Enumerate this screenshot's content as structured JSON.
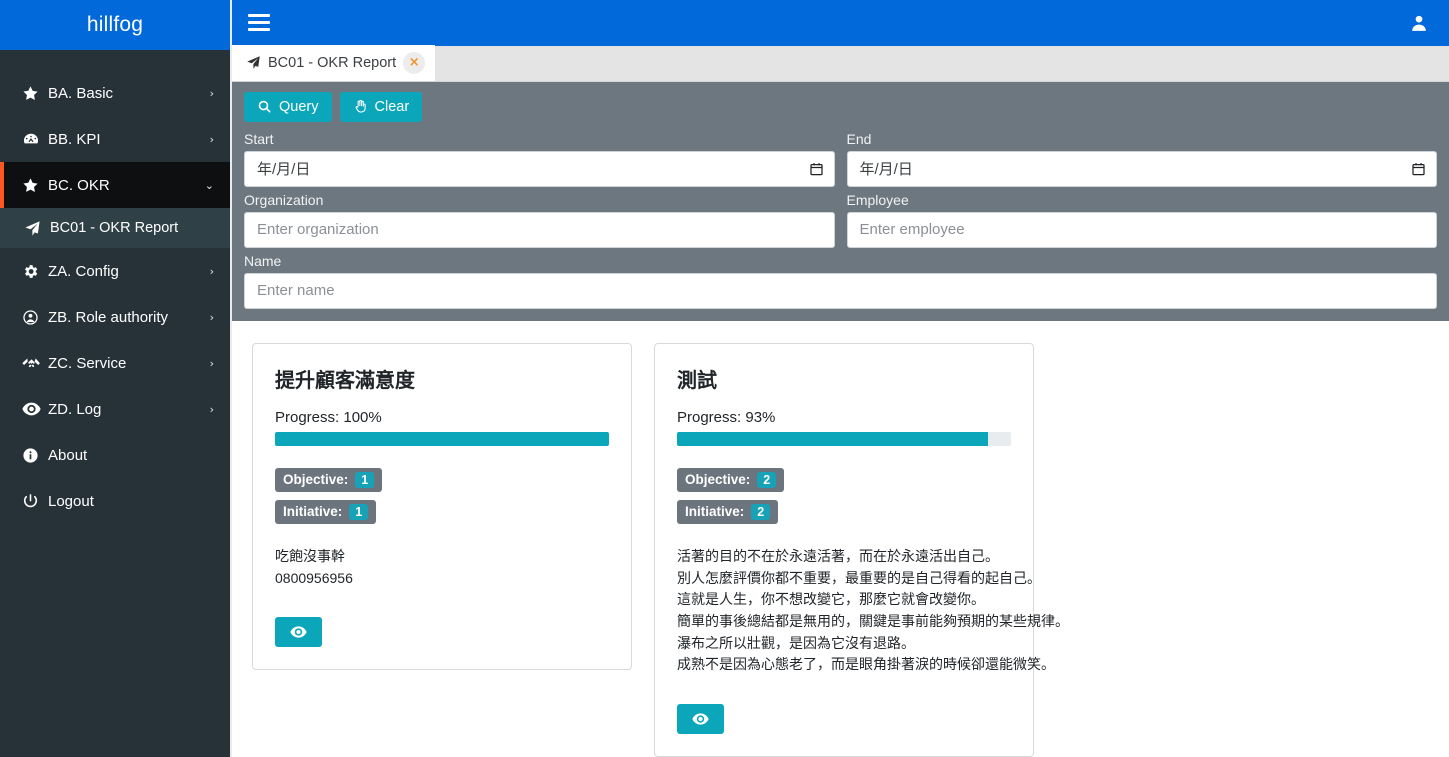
{
  "brand": {
    "name": "hillfog"
  },
  "sidebar": {
    "items": [
      {
        "label": "BA. Basic",
        "icon": "star-icon",
        "caret": "›",
        "state": "collapsed"
      },
      {
        "label": "BB. KPI",
        "icon": "dashboard-icon",
        "caret": "›",
        "state": "collapsed"
      },
      {
        "label": "BC. OKR",
        "icon": "star-icon",
        "caret": "⌄",
        "state": "expanded"
      },
      {
        "label": "BC01 - OKR Report",
        "icon": "paper-plane-icon",
        "caret": "",
        "state": "sub-active"
      },
      {
        "label": "ZA. Config",
        "icon": "gear-icon",
        "caret": "›",
        "state": "collapsed"
      },
      {
        "label": "ZB. Role authority",
        "icon": "user-circle-icon",
        "caret": "›",
        "state": "collapsed"
      },
      {
        "label": "ZC. Service",
        "icon": "handshake-icon",
        "caret": "›",
        "state": "collapsed"
      },
      {
        "label": "ZD. Log",
        "icon": "eye-icon",
        "caret": "›",
        "state": "collapsed"
      },
      {
        "label": "About",
        "icon": "info-icon",
        "caret": "",
        "state": "plain"
      },
      {
        "label": "Logout",
        "icon": "power-icon",
        "caret": "",
        "state": "plain"
      }
    ]
  },
  "topbar": {
    "menu_icon": "hamburger-icon",
    "user_icon": "user-icon"
  },
  "tab": {
    "icon": "paper-plane-icon",
    "label": "BC01 - OKR Report",
    "close": "×"
  },
  "filter": {
    "query_label": "Query",
    "clear_label": "Clear",
    "fields": {
      "start": {
        "label": "Start",
        "value": "年/月/日",
        "placeholder": "年/月/日",
        "type": "date"
      },
      "end": {
        "label": "End",
        "value": "年/月/日",
        "placeholder": "年/月/日",
        "type": "date"
      },
      "organization": {
        "label": "Organization",
        "value": "",
        "placeholder": "Enter organization",
        "type": "text"
      },
      "employee": {
        "label": "Employee",
        "value": "",
        "placeholder": "Enter employee",
        "type": "text"
      },
      "name": {
        "label": "Name",
        "value": "",
        "placeholder": "Enter name",
        "type": "text"
      }
    }
  },
  "cards": [
    {
      "title": "提升顧客滿意度",
      "progress_label": "Progress: 100%",
      "progress_percent": 100,
      "objective_label": "Objective:",
      "objective_count": "1",
      "initiative_label": "Initiative:",
      "initiative_count": "1",
      "lines": [
        "吃飽沒事幹",
        "0800956956"
      ],
      "view_icon": "eye-icon"
    },
    {
      "title": "測試",
      "progress_label": "Progress: 93%",
      "progress_percent": 93,
      "objective_label": "Objective:",
      "objective_count": "2",
      "initiative_label": "Initiative:",
      "initiative_count": "2",
      "lines": [
        "活著的目的不在於永遠活著，而在於永遠活出自己。",
        "別人怎麼評價你都不重要，最重要的是自己得看的起自己。",
        "這就是人生，你不想改變它，那麼它就會改變你。",
        "簡單的事後總結都是無用的，關鍵是事前能夠預期的某些規律。",
        "瀑布之所以壯觀，是因為它沒有退路。",
        "成熟不是因為心態老了，而是眼角掛著淚的時候卻還能微笑。"
      ],
      "view_icon": "eye-icon"
    }
  ],
  "colors": {
    "brand_blue": "#0169d9",
    "sidebar_dark": "#263238",
    "accent_orange": "#ff5722",
    "teal": "#0ba6b9",
    "panel_gray": "#6c7780",
    "badge_gray": "#6c757d",
    "badge_count_teal": "#17a2b8"
  }
}
